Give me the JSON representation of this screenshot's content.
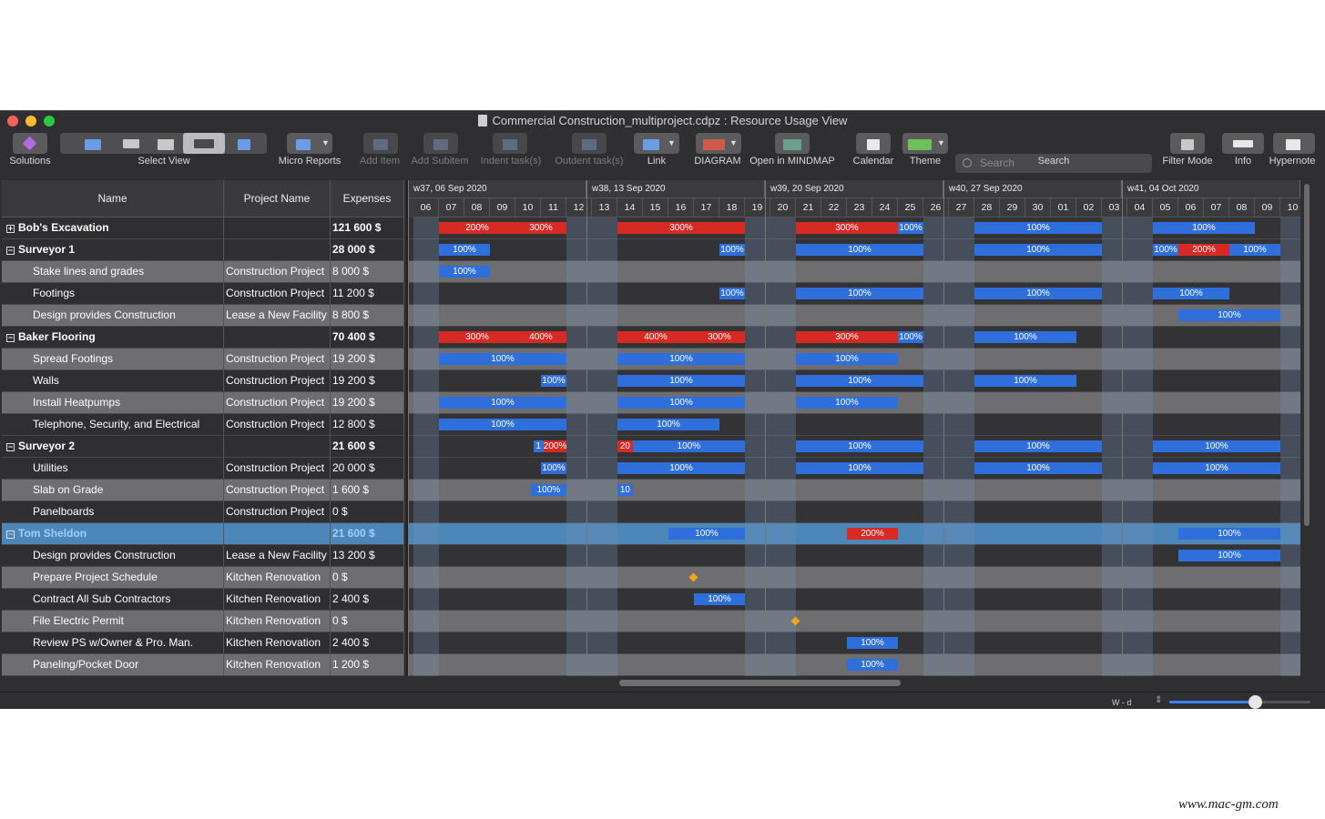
{
  "window": {
    "title": "Commercial Construction_multiproject.cdpz : Resource Usage View"
  },
  "toolbar": {
    "solutions": "Solutions",
    "select_view": "Select View",
    "micro_reports": "Micro Reports",
    "add_item": "Add Item",
    "add_subitem": "Add Subitem",
    "indent": "Indent task(s)",
    "outdent": "Outdent task(s)",
    "link": "Link",
    "diagram": "DIAGRAM",
    "mindmap": "Open in MINDMAP",
    "calendar": "Calendar",
    "theme": "Theme",
    "search_label": "Search",
    "search_placeholder": "Search",
    "filter_mode": "Filter Mode",
    "info": "Info",
    "hypernote": "Hypernote"
  },
  "table": {
    "headers": {
      "name": "Name",
      "project": "Project Name",
      "expenses": "Expenses"
    }
  },
  "timeline": {
    "weeks": [
      "w37, 06 Sep 2020",
      "w38, 13 Sep 2020",
      "w39, 20 Sep 2020",
      "w40, 27 Sep 2020",
      "w41, 04 Oct 2020"
    ],
    "days": [
      "06",
      "07",
      "08",
      "09",
      "10",
      "11",
      "12",
      "13",
      "14",
      "15",
      "16",
      "17",
      "18",
      "19",
      "20",
      "21",
      "22",
      "23",
      "24",
      "25",
      "26",
      "27",
      "28",
      "29",
      "30",
      "01",
      "02",
      "03",
      "04",
      "05",
      "06",
      "07",
      "08",
      "09",
      "10"
    ]
  },
  "rows": [
    {
      "name": "Bob's Excavation",
      "project": "",
      "expenses": "121 600 $",
      "level": 0,
      "expander": "+",
      "bars": [
        {
          "s": 1,
          "e": 4,
          "c": "r",
          "t": "200%"
        },
        {
          "s": 4,
          "e": 6,
          "c": "r",
          "t": "300%"
        },
        {
          "s": 8,
          "e": 13,
          "c": "r",
          "t": "300%"
        },
        {
          "s": 15,
          "e": 19,
          "c": "r",
          "t": "300%"
        },
        {
          "s": 19,
          "e": 20,
          "c": "b",
          "t": "100%"
        },
        {
          "s": 22,
          "e": 27,
          "c": "b",
          "t": "100%"
        },
        {
          "s": 29,
          "e": 33,
          "c": "b",
          "t": "100%"
        }
      ]
    },
    {
      "name": "Surveyor 1",
      "project": "",
      "expenses": "28 000 $",
      "level": 0,
      "expander": "−",
      "bars": [
        {
          "s": 1,
          "e": 3,
          "c": "b",
          "t": "100%"
        },
        {
          "s": 12,
          "e": 13,
          "c": "b",
          "t": "100%"
        },
        {
          "s": 15,
          "e": 20,
          "c": "b",
          "t": "100%"
        },
        {
          "s": 22,
          "e": 27,
          "c": "b",
          "t": "100%"
        },
        {
          "s": 29,
          "e": 30,
          "c": "b",
          "t": "100%"
        },
        {
          "s": 30,
          "e": 32,
          "c": "r",
          "t": "200%"
        },
        {
          "s": 32,
          "e": 34,
          "c": "b",
          "t": "100%"
        }
      ]
    },
    {
      "name": "Stake lines and grades",
      "project": "Construction Project",
      "expenses": "8 000 $",
      "level": 1,
      "bars": [
        {
          "s": 1,
          "e": 3,
          "c": "b",
          "t": "100%"
        }
      ]
    },
    {
      "name": "Footings",
      "project": "Construction Project",
      "expenses": "11 200 $",
      "level": 1,
      "bars": [
        {
          "s": 12,
          "e": 13,
          "c": "b",
          "t": "100%"
        },
        {
          "s": 15,
          "e": 20,
          "c": "b",
          "t": "100%"
        },
        {
          "s": 22,
          "e": 27,
          "c": "b",
          "t": "100%"
        },
        {
          "s": 29,
          "e": 32,
          "c": "b",
          "t": "100%"
        }
      ]
    },
    {
      "name": "Design provides Construction",
      "project": "Lease a New Facility",
      "expenses": "8 800 $",
      "level": 1,
      "bars": [
        {
          "s": 30,
          "e": 34,
          "c": "b",
          "t": "100%"
        }
      ]
    },
    {
      "name": "Baker Flooring",
      "project": "",
      "expenses": "70 400 $",
      "level": 0,
      "expander": "−",
      "bars": [
        {
          "s": 1,
          "e": 4,
          "c": "r",
          "t": "300%"
        },
        {
          "s": 4,
          "e": 6,
          "c": "r",
          "t": "400%"
        },
        {
          "s": 8,
          "e": 11,
          "c": "r",
          "t": "400%"
        },
        {
          "s": 11,
          "e": 13,
          "c": "r",
          "t": "300%"
        },
        {
          "s": 15,
          "e": 19,
          "c": "r",
          "t": "300%"
        },
        {
          "s": 19,
          "e": 20,
          "c": "b",
          "t": "100%"
        },
        {
          "s": 22,
          "e": 26,
          "c": "b",
          "t": "100%"
        }
      ]
    },
    {
      "name": "Spread Footings",
      "project": "Construction Project",
      "expenses": "19 200 $",
      "level": 1,
      "bars": [
        {
          "s": 1,
          "e": 6,
          "c": "b",
          "t": "100%"
        },
        {
          "s": 8,
          "e": 13,
          "c": "b",
          "t": "100%"
        },
        {
          "s": 15,
          "e": 19,
          "c": "b",
          "t": "100%"
        }
      ]
    },
    {
      "name": "Walls",
      "project": "Construction Project",
      "expenses": "19 200 $",
      "level": 1,
      "bars": [
        {
          "s": 5,
          "e": 6,
          "c": "b",
          "t": "100%"
        },
        {
          "s": 8,
          "e": 13,
          "c": "b",
          "t": "100%"
        },
        {
          "s": 15,
          "e": 20,
          "c": "b",
          "t": "100%"
        },
        {
          "s": 22,
          "e": 26,
          "c": "b",
          "t": "100%"
        }
      ]
    },
    {
      "name": "Install Heatpumps",
      "project": "Construction Project",
      "expenses": "19 200 $",
      "level": 1,
      "bars": [
        {
          "s": 1,
          "e": 6,
          "c": "b",
          "t": "100%"
        },
        {
          "s": 8,
          "e": 13,
          "c": "b",
          "t": "100%"
        },
        {
          "s": 15,
          "e": 19,
          "c": "b",
          "t": "100%"
        }
      ]
    },
    {
      "name": "Telephone, Security, and Electrical",
      "project": "Construction Project",
      "expenses": "12 800 $",
      "level": 1,
      "bars": [
        {
          "s": 1,
          "e": 6,
          "c": "b",
          "t": "100%"
        },
        {
          "s": 8,
          "e": 12,
          "c": "b",
          "t": "100%"
        }
      ]
    },
    {
      "name": "Surveyor 2",
      "project": "",
      "expenses": "21 600 $",
      "level": 0,
      "expander": "−",
      "bars": [
        {
          "s": 4.7,
          "e": 5.1,
          "c": "b",
          "t": "1"
        },
        {
          "s": 5.1,
          "e": 6,
          "c": "r",
          "t": "200%"
        },
        {
          "s": 8,
          "e": 8.6,
          "c": "r",
          "t": "20"
        },
        {
          "s": 8.6,
          "e": 13,
          "c": "b",
          "t": "100%"
        },
        {
          "s": 15,
          "e": 20,
          "c": "b",
          "t": "100%"
        },
        {
          "s": 22,
          "e": 27,
          "c": "b",
          "t": "100%"
        },
        {
          "s": 29,
          "e": 34,
          "c": "b",
          "t": "100%"
        }
      ]
    },
    {
      "name": "Utilities",
      "project": "Construction Project",
      "expenses": "20 000 $",
      "level": 1,
      "bars": [
        {
          "s": 5,
          "e": 6,
          "c": "b",
          "t": "100%"
        },
        {
          "s": 8,
          "e": 13,
          "c": "b",
          "t": "100%"
        },
        {
          "s": 15,
          "e": 20,
          "c": "b",
          "t": "100%"
        },
        {
          "s": 22,
          "e": 27,
          "c": "b",
          "t": "100%"
        },
        {
          "s": 29,
          "e": 34,
          "c": "b",
          "t": "100%"
        }
      ]
    },
    {
      "name": "Slab on Grade",
      "project": "Construction Project",
      "expenses": "1 600 $",
      "level": 1,
      "bars": [
        {
          "s": 4.6,
          "e": 6,
          "c": "b",
          "t": "100%"
        },
        {
          "s": 8,
          "e": 8.6,
          "c": "b",
          "t": "10"
        }
      ]
    },
    {
      "name": "Panelboards",
      "project": "Construction Project",
      "expenses": "0 $",
      "level": 1,
      "bars": []
    },
    {
      "name": "Tom Sheldon",
      "project": "",
      "expenses": "21 600 $",
      "level": 0,
      "expander": "−",
      "selected": true,
      "bars": [
        {
          "s": 10,
          "e": 13,
          "c": "b",
          "t": "100%"
        },
        {
          "s": 17,
          "e": 19,
          "c": "r",
          "t": "200%"
        },
        {
          "s": 30,
          "e": 34,
          "c": "b",
          "t": "100%"
        }
      ]
    },
    {
      "name": "Design provides Construction",
      "project": "Lease a New Facility",
      "expenses": "13 200 $",
      "level": 1,
      "bars": [
        {
          "s": 30,
          "e": 34,
          "c": "b",
          "t": "100%"
        }
      ]
    },
    {
      "name": "Prepare Project Schedule",
      "project": "Kitchen Renovation",
      "expenses": "0 $",
      "level": 1,
      "bars": [],
      "milestone": 11
    },
    {
      "name": "Contract All Sub Contractors",
      "project": "Kitchen Renovation",
      "expenses": "2 400 $",
      "level": 1,
      "bars": [
        {
          "s": 11,
          "e": 13,
          "c": "b",
          "t": "100%"
        }
      ]
    },
    {
      "name": "File Electric Permit",
      "project": "Kitchen Renovation",
      "expenses": "0 $",
      "level": 1,
      "bars": [],
      "milestone": 15
    },
    {
      "name": "Review PS w/Owner & Pro. Man.",
      "project": "Kitchen Renovation",
      "expenses": "2 400 $",
      "level": 1,
      "bars": [
        {
          "s": 17,
          "e": 19,
          "c": "b",
          "t": "100%"
        }
      ]
    },
    {
      "name": "Paneling/Pocket Door",
      "project": "Kitchen Renovation",
      "expenses": "1 200 $",
      "level": 1,
      "bars": [
        {
          "s": 17,
          "e": 19,
          "c": "b",
          "t": "100%"
        }
      ]
    }
  ],
  "statusbar": {
    "zoom_label": "W - d",
    "zoom_level": 0.6
  },
  "watermark": "www.mac-gm.com",
  "colors": {
    "overload": "#d72a25",
    "normal": "#2f6fdb",
    "milestone": "#f0a21a",
    "selected_row": "#4d86b8"
  }
}
